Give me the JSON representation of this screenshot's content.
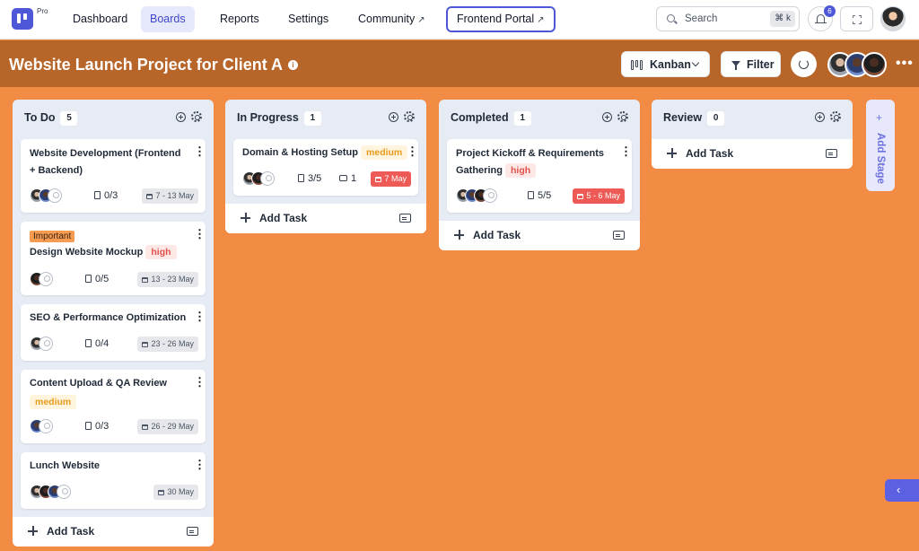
{
  "nav": {
    "pro_label": "Pro",
    "items": [
      {
        "label": "Dashboard"
      },
      {
        "label": "Boards"
      },
      {
        "label": "Reports"
      },
      {
        "label": "Settings"
      },
      {
        "label": "Community"
      },
      {
        "label": "Frontend Portal"
      }
    ],
    "search_label": "Search",
    "search_shortcut": "⌘ k",
    "notification_count": "6"
  },
  "project": {
    "title": "Website Launch Project for Client A",
    "view_label": "Kanban",
    "filter_label": "Filter"
  },
  "columns": [
    {
      "title": "To Do",
      "count": "5",
      "add_task_label": "Add Task",
      "cards": [
        {
          "title": "Website Development (Frontend + Backend)",
          "subtasks": "0/3",
          "date": "7 - 13 May"
        },
        {
          "badge": "Important",
          "title": "Design Website Mockup",
          "priority": "high",
          "subtasks": "0/5",
          "date": "13 - 23 May"
        },
        {
          "title": "SEO & Performance Optimization",
          "subtasks": "0/4",
          "date": "23 - 26 May"
        },
        {
          "title": "Content Upload & QA Review",
          "priority": "medium",
          "subtasks": "0/3",
          "date": "26 - 29 May"
        },
        {
          "title": "Lunch Website",
          "date": "30 May"
        }
      ]
    },
    {
      "title": "In Progress",
      "count": "1",
      "add_task_label": "Add Task",
      "cards": [
        {
          "title": "Domain & Hosting Setup",
          "priority": "medium",
          "subtasks": "3/5",
          "comments": "1",
          "date": "7 May"
        }
      ]
    },
    {
      "title": "Completed",
      "count": "1",
      "add_task_label": "Add Task",
      "cards": [
        {
          "title": "Project Kickoff & Requirements Gathering",
          "priority": "high",
          "subtasks": "5/5",
          "date": "5 - 6 May"
        }
      ]
    },
    {
      "title": "Review",
      "count": "0",
      "add_task_label": "Add Task",
      "cards": []
    }
  ],
  "add_stage_label": "Add Stage",
  "colors": {
    "accent": "#4f57d9",
    "board_background": "#f28c45",
    "header_background": "#b8652a",
    "overdue": "#ee5a55"
  }
}
